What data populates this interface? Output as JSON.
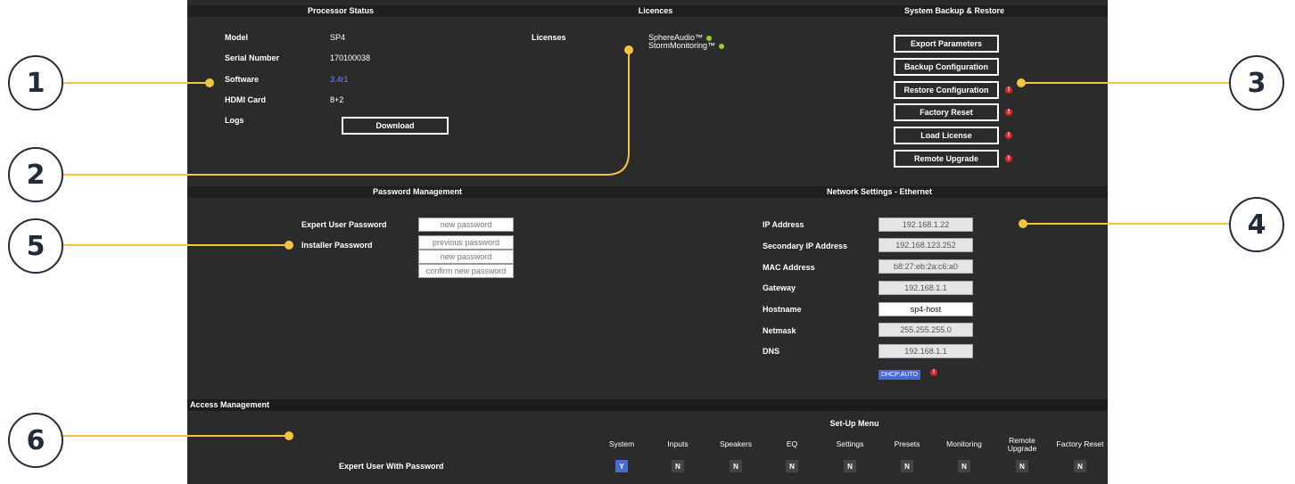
{
  "processor_status": {
    "title": "Processor Status",
    "rows": [
      {
        "label": "Model",
        "value": "SP4"
      },
      {
        "label": "Serial Number",
        "value": "170100038"
      },
      {
        "label": "Software",
        "value": "3.4r1"
      },
      {
        "label": "HDMI Card",
        "value": "8+2"
      },
      {
        "label": "Logs",
        "value": ""
      }
    ],
    "download_label": "Download",
    "software_link_color": "#6b8cff"
  },
  "licences": {
    "title": "Licences",
    "label": "Licenses",
    "items": [
      "SphereAudio™",
      "StormMonitoring™"
    ],
    "status_color": "#9acd32"
  },
  "backup": {
    "title": "System Backup & Restore",
    "buttons": [
      {
        "label": "Export Parameters",
        "warning": false
      },
      {
        "label": "Backup Configuration",
        "warning": false
      },
      {
        "label": "Restore Configuration",
        "warning": true
      },
      {
        "label": "Factory Reset",
        "warning": true
      },
      {
        "label": "Load License",
        "warning": true
      },
      {
        "label": "Remote Upgrade",
        "warning": true
      }
    ],
    "warning_glyph": "!"
  },
  "password": {
    "title": "Password Management",
    "expert_label": "Expert User Password",
    "installer_label": "Installer Password",
    "expert_placeholder": "new password",
    "installer_fields": [
      "previous password",
      "new password",
      "confirm new password"
    ]
  },
  "network": {
    "title": "Network Settings - Ethernet",
    "fields": [
      {
        "label": "IP Address",
        "value": "192.168.1.22"
      },
      {
        "label": "Secondary IP Address",
        "value": "192.168.123.252"
      },
      {
        "label": "MAC Address",
        "value": "b8:27:eb:2a:c6:a0"
      },
      {
        "label": "Gateway",
        "value": "192.168.1.1"
      },
      {
        "label": "Hostname",
        "value": "sp4-host"
      },
      {
        "label": "Netmask",
        "value": "255.255.255.0"
      },
      {
        "label": "DNS",
        "value": "192.168.1.1"
      }
    ],
    "dhcp_label": "DHCP:AUTO"
  },
  "access": {
    "title": "Access Management",
    "menu_title": "Set-Up Menu",
    "columns": [
      "System",
      "Inputs",
      "Speakers",
      "EQ",
      "Settings",
      "Presets",
      "Monitoring",
      "Remote\nUpgrade",
      "Factory Reset"
    ],
    "row_label": "Expert User With Password",
    "permissions": [
      "Y",
      "N",
      "N",
      "N",
      "N",
      "N",
      "N",
      "N",
      "N"
    ],
    "accent_color": "#4a68d6"
  },
  "callouts": [
    "1",
    "2",
    "3",
    "4",
    "5",
    "6"
  ],
  "colors": {
    "panel_bg": "#2b2b2b",
    "header_bg": "#1f1f1f",
    "leader_color": "#f5c242",
    "callout_border": "#232b3a"
  }
}
